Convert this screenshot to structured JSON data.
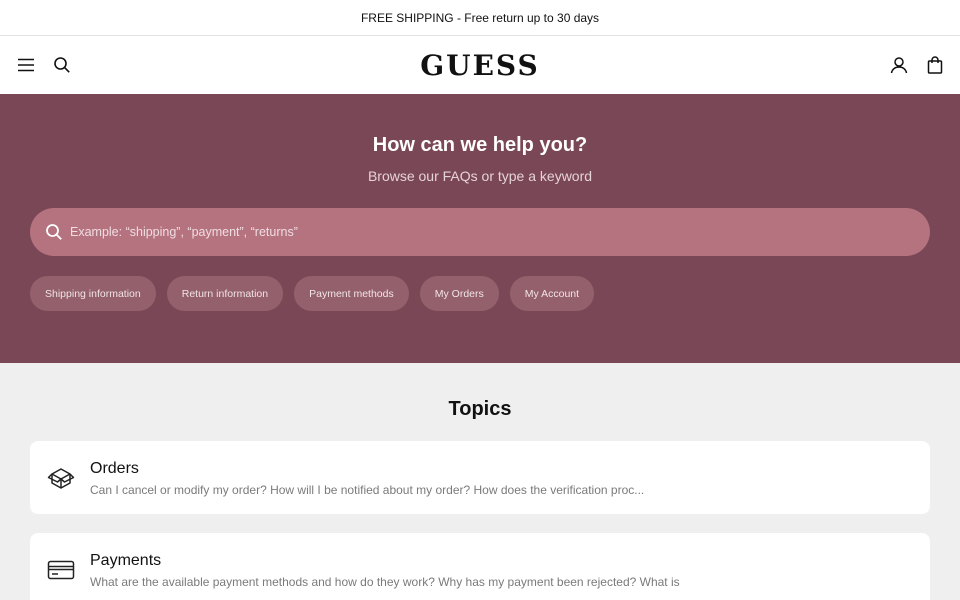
{
  "promo_bar": {
    "text": "FREE SHIPPING - Free return up to 30 days"
  },
  "header": {
    "logo": "GUESS",
    "icons": {
      "menu": "menu-icon",
      "search": "search-icon",
      "account": "user-icon",
      "bag": "shopping-bag-icon"
    }
  },
  "hero": {
    "title": "How can we help you?",
    "subtitle": "Browse our FAQs or type a keyword",
    "search": {
      "placeholder": "Example: “shipping”, “payment”, “returns”",
      "value": ""
    },
    "quick_links": [
      {
        "label": "Shipping information"
      },
      {
        "label": "Return information"
      },
      {
        "label": "Payment methods"
      },
      {
        "label": "My Orders"
      },
      {
        "label": "My Account"
      }
    ],
    "colors": {
      "background": "#7a4756",
      "search_bg": "#b5737f",
      "chip_bg": "#93606c"
    }
  },
  "topics": {
    "title": "Topics",
    "items": [
      {
        "title": "Orders",
        "description": "Can I cancel or modify my order? How will I be notified about my order? How does the verification proc...",
        "icon": "box-icon"
      },
      {
        "title": "Payments",
        "description": "What are the available payment methods and how do they work? Why has my payment been rejected? What is",
        "icon": "credit-card-icon"
      }
    ]
  }
}
